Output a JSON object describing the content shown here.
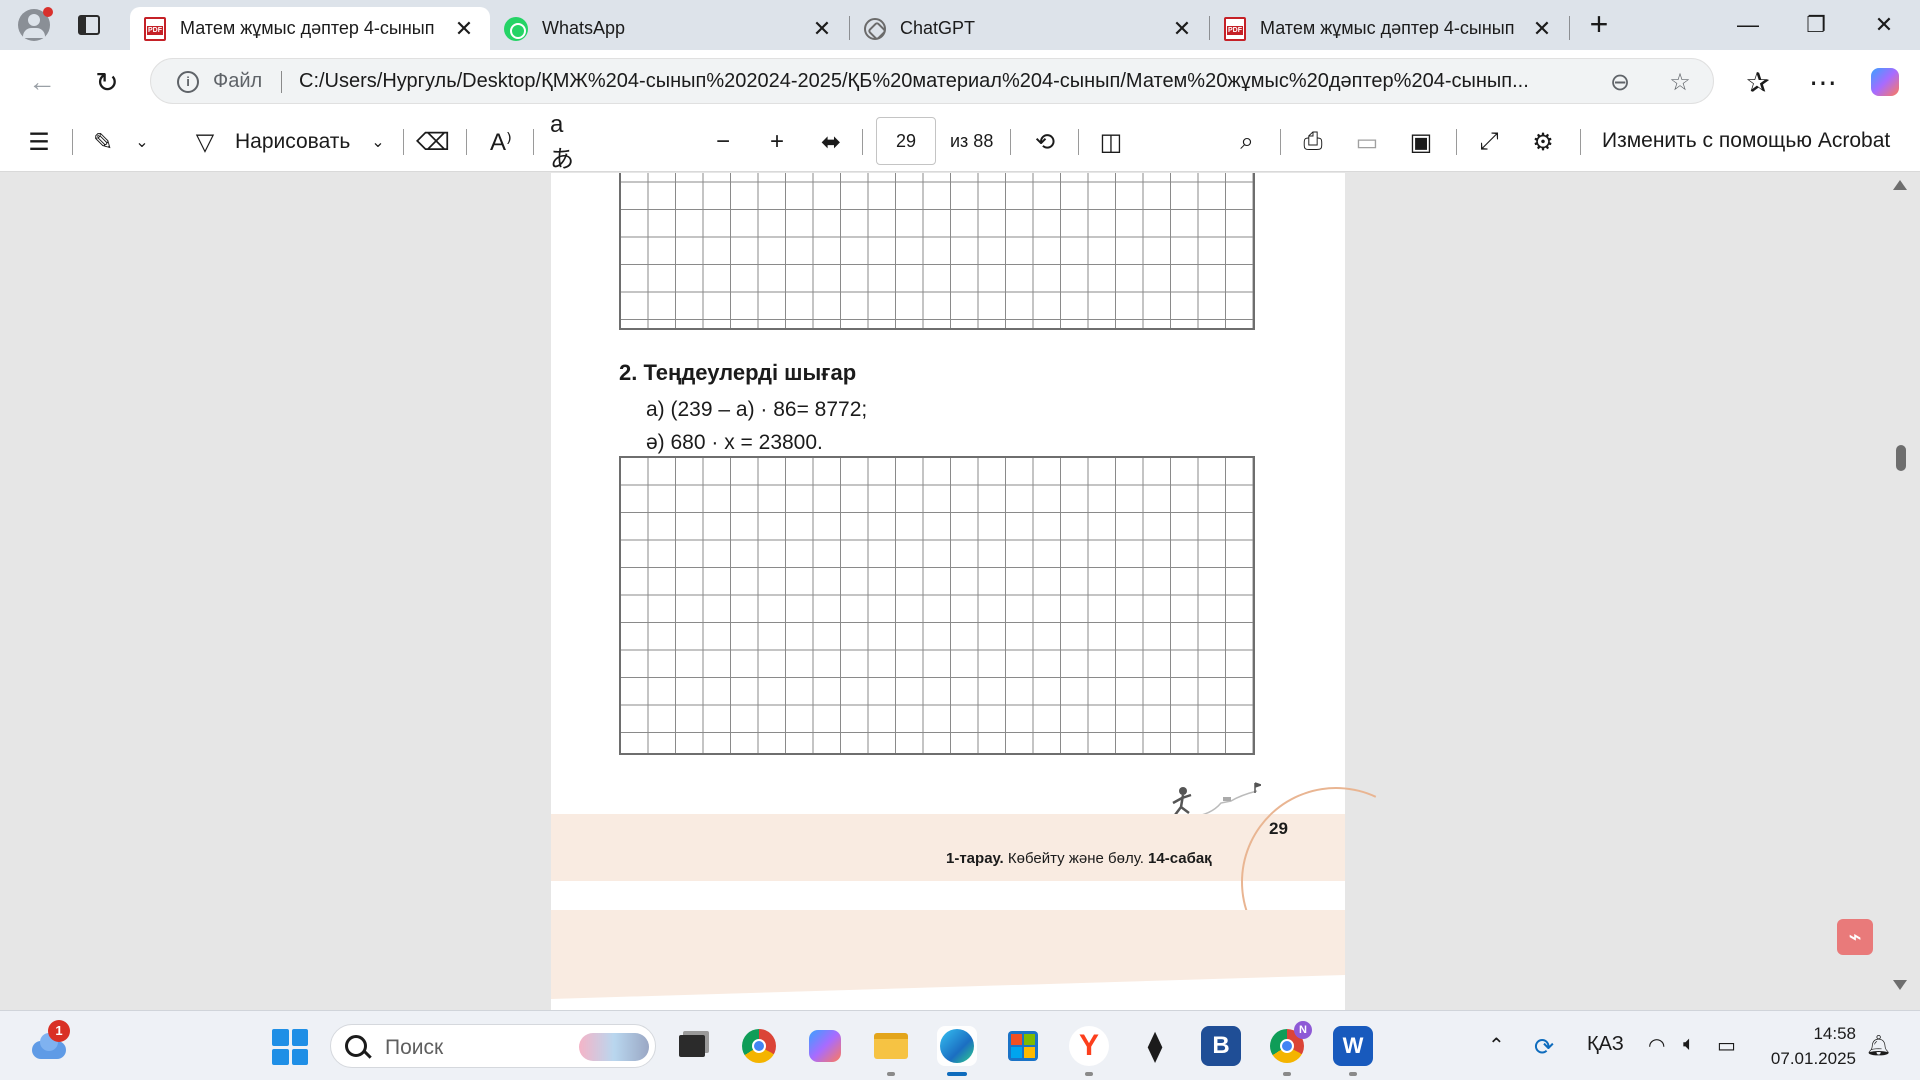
{
  "tabs": [
    {
      "label": "Матем жұмыс дәптер 4-сынып",
      "favicon": "pdf-icon",
      "active": true
    },
    {
      "label": "WhatsApp",
      "favicon": "whatsapp-icon",
      "active": false
    },
    {
      "label": "ChatGPT",
      "favicon": "chatgpt-icon",
      "active": false
    },
    {
      "label": "Матем жұмыс дәптер 4-сынып",
      "favicon": "pdf-icon",
      "active": false
    }
  ],
  "address": {
    "scheme_label": "Файл",
    "url": "C:/Users/Нургуль/Desktop/ҚМЖ%204-сынып%202024-2025/ҚБ%20материал%204-сынып/Матем%20жұмыс%20дәптер%204-сынып..."
  },
  "pdf_toolbar": {
    "draw_label": "Нарисовать",
    "current_page": "29",
    "total_pages": "из 88",
    "acrobat_label": "Изменить с помощью Acrobat"
  },
  "document": {
    "task_title": "2. Теңдеулерді шығар",
    "eq_a": "а) (239 – a) · 86= 8772;",
    "eq_b": "ә) 680 · x = 23800.",
    "footer_part": "1-тарау.",
    "footer_topic": "Көбейту және бөлу.",
    "footer_lesson": "14-сабақ",
    "page_number": "29"
  },
  "taskbar": {
    "weather_badge": "1",
    "search_placeholder": "Поиск",
    "language": "ҚАЗ",
    "time": "14:58",
    "date": "07.01.2025"
  },
  "colors": {
    "tabbar_bg": "#dde3ea",
    "footer_band": "#f9ebe1",
    "accent_blue": "#0f6cbd",
    "pdf_red": "#c52127"
  }
}
